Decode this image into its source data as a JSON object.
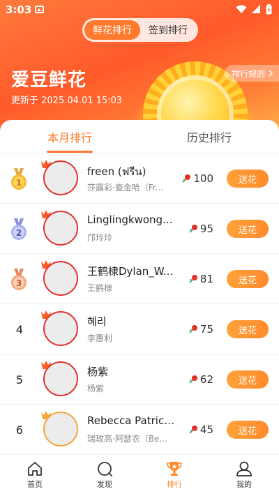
{
  "status_bar": {
    "time": "3:03"
  },
  "segment": {
    "options": [
      "鲜花排行",
      "签到排行"
    ],
    "selected": 0
  },
  "hero": {
    "title": "爱豆鲜花",
    "updated": "更新于 2025.04.01 15:03",
    "rules_button": "排行规则"
  },
  "tabs": [
    {
      "label": "本月排行"
    },
    {
      "label": "历史排行"
    }
  ],
  "colors": {
    "accent": "#ff7a2c",
    "avatar_ring": "#e0322c"
  },
  "ranking": [
    {
      "rank": "1",
      "name": "freen (ฟรีน)",
      "subtitle": "莎露彩·查金哈（Fr...",
      "flowers": "100",
      "action": "送花"
    },
    {
      "rank": "2",
      "name": "Linglingkwong...",
      "subtitle": "邝玲玲",
      "flowers": "95",
      "action": "送花"
    },
    {
      "rank": "3",
      "name": "王鹤棣Dylan_W...",
      "subtitle": "王鹤棣",
      "flowers": "81",
      "action": "送花"
    },
    {
      "rank": "4",
      "name": "혜리",
      "subtitle": "李惠利",
      "flowers": "75",
      "action": "送花"
    },
    {
      "rank": "5",
      "name": "杨紫",
      "subtitle": "杨紫",
      "flowers": "62",
      "action": "送花"
    },
    {
      "rank": "6",
      "name": "Rebecca Patrici...",
      "subtitle": "瑞玫高·阿瑟农（Be...",
      "flowers": "45",
      "action": "送花"
    }
  ],
  "bottom_nav": [
    {
      "label": "首页",
      "icon": "home-icon"
    },
    {
      "label": "发现",
      "icon": "discover-icon"
    },
    {
      "label": "排行",
      "icon": "trophy-icon"
    },
    {
      "label": "我的",
      "icon": "profile-icon"
    }
  ]
}
